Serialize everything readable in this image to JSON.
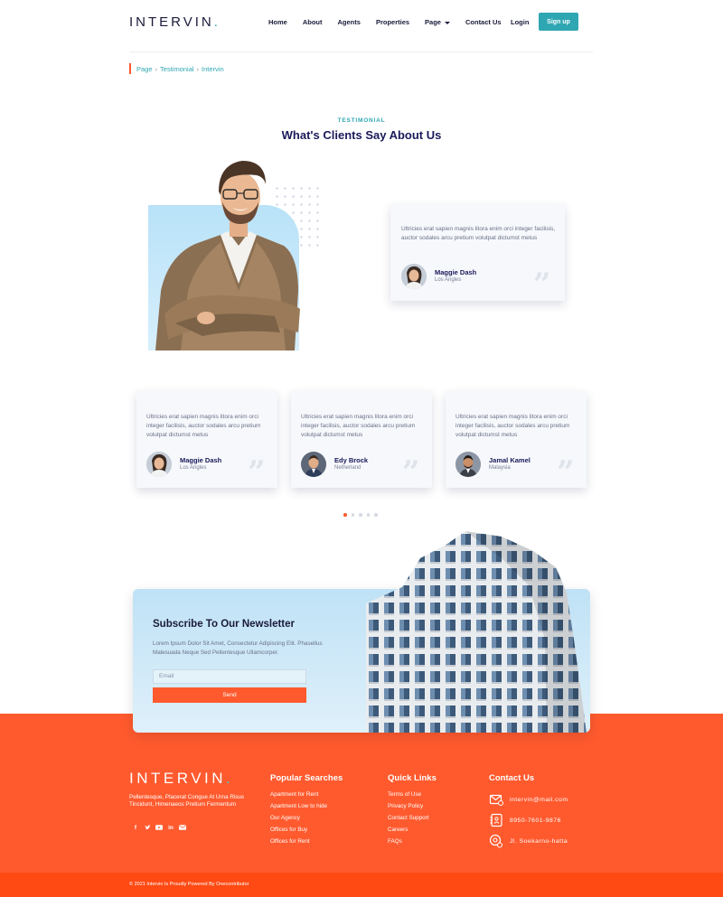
{
  "nav": {
    "logo": "INTERVIN",
    "logo_dot": ".",
    "menu": [
      "Home",
      "About",
      "Agents",
      "Properties",
      "Page",
      "Contact Us"
    ],
    "login": "Login",
    "signup": "Sign up"
  },
  "breadcrumb": [
    "Page",
    "Testimonial",
    "Intervin"
  ],
  "section": {
    "tag": "TESTIMONIAL",
    "title": "What's Clients Say About Us"
  },
  "featured": {
    "text": "Ultricies erat sapien magnis litora enim orci integer facilisis, auctor sodales arcu pretium volutpat dictumst metus",
    "name": "Maggie Dash",
    "location": "Los Angles"
  },
  "testimonials": [
    {
      "text": "Ultricies erat sapien magnis litora enim orci integer facilisis, auctor sodales arcu pretium volutpat dictumst metus",
      "name": "Maggie Dash",
      "location": "Los Angles"
    },
    {
      "text": "Ultricies erat sapien magnis litora enim orci integer facilisis, auctor sodales arcu pretium volutpat dictumst metus",
      "name": "Edy Brock",
      "location": "Netherland"
    },
    {
      "text": "Ultricies erat sapien magnis litora enim orci integer facilisis, auctor sodales arcu pretium volutpat dictumst metus",
      "name": "Jamal Kamel",
      "location": "Malaysia"
    }
  ],
  "quote_mark": "”",
  "pager": {
    "count": 5,
    "active": 0
  },
  "newsletter": {
    "title": "Subscribe To Our Newsletter",
    "subtitle": "Lorem Ipsum Dolor Sit Amet, Consectetur Adipiscing Elit. Phasellus Malesuada Neque Sed Pellentesque Ullamcorper.",
    "email_placeholder": "Email",
    "send": "Send"
  },
  "footer": {
    "logo": "INTERVIN",
    "logo_dot": ".",
    "description": "Pellentesque, Placerat Congue At Urna Risus Tincidunt, Himenaeos Pretium Fermentum",
    "social_icons": [
      "facebook-icon",
      "twitter-icon",
      "youtube-icon",
      "linkedin-icon",
      "mail-icon"
    ],
    "popular_title": "Popular Searches",
    "popular": [
      "Apartment for Rent",
      "Apartment Low to hide",
      "Our Agency",
      "Offices for Buy",
      "Offices for Rent"
    ],
    "quick_title": "Quick Links",
    "quick": [
      "Terms of Use",
      "Privacy Policy",
      "Contact Support",
      "Careers",
      "FAQs"
    ],
    "contact_title": "Contact Us",
    "contact": [
      "intervin@mail.com",
      "8950-7601-9876",
      "Jl. Soekarno-hatta"
    ],
    "copyright": "© 2021 Intervin Is Proudly Powered By Onecontributor"
  },
  "colors": {
    "accent": "#2fa7b3",
    "brand_orange": "#ff5a2e",
    "heading": "#1a1a5a"
  }
}
